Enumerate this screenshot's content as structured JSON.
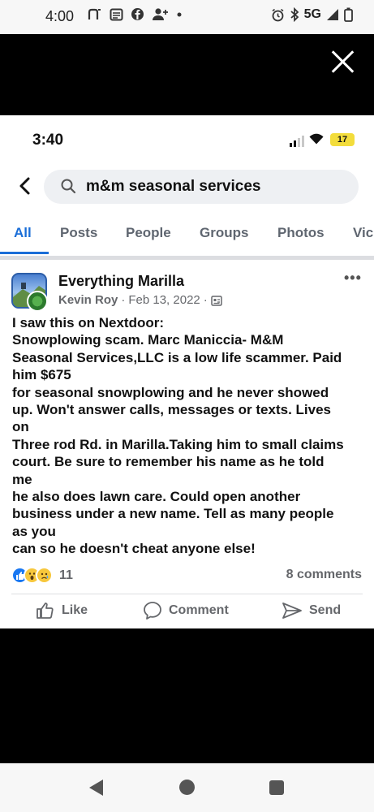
{
  "outer_status": {
    "time": "4:00",
    "left_icons": [
      "notification-n-icon",
      "message-icon",
      "facebook-icon",
      "add-person-icon",
      "dot-icon"
    ],
    "right_icons": [
      "alarm-icon",
      "bluetooth-icon",
      "5g-signal-icon",
      "battery-icon"
    ],
    "network": "5G"
  },
  "inner_status": {
    "time": "3:40",
    "battery": "17",
    "battery_color": "#f3dd3c"
  },
  "search": {
    "query": "m&m seasonal services"
  },
  "tabs": [
    {
      "label": "All",
      "active": true
    },
    {
      "label": "Posts"
    },
    {
      "label": "People"
    },
    {
      "label": "Groups"
    },
    {
      "label": "Photos"
    },
    {
      "label": "Vic"
    }
  ],
  "post": {
    "group_name": "Everything Marilla",
    "author": "Kevin Roy",
    "separator": "·",
    "date": "Feb 13, 2022",
    "more": "•••",
    "body_lines": [
      "I saw this on Nextdoor:",
      "Snowplowing scam. Marc Maniccia- M&M",
      "Seasonal Services,LLC is a low life scammer. Paid",
      "him $675",
      "for seasonal snowplowing and he never showed",
      "up. Won't answer calls, messages or texts. Lives",
      "on",
      "Three rod Rd. in Marilla.Taking him to small claims",
      "court.  Be sure to remember his name as he told",
      "me",
      "he also does lawn care. Could open another",
      "business under a new name. Tell as many people",
      "as you",
      "can so he doesn't cheat anyone else!"
    ],
    "reaction_count": "11",
    "comments": "8 comments",
    "actions": {
      "like": "Like",
      "comment": "Comment",
      "send": "Send"
    }
  },
  "colors": {
    "accent": "#1a6ed8",
    "like_blue": "#1877f2",
    "muted_text": "#65676b"
  }
}
